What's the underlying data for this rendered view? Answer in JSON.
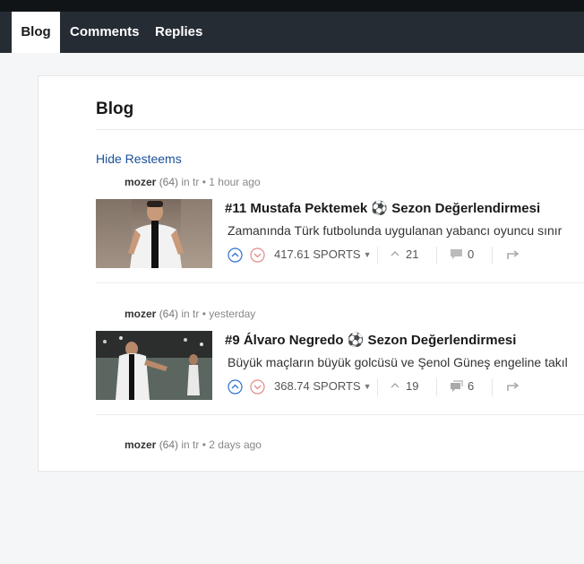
{
  "tabs": [
    {
      "label": "Blog",
      "active": true
    },
    {
      "label": "Comments",
      "active": false
    },
    {
      "label": "Replies",
      "active": false
    }
  ],
  "page_title": "Blog",
  "hide_resteems": "Hide Resteems",
  "posts": [
    {
      "author": "mozer",
      "reputation": "(64)",
      "category": "in tr",
      "time": "1 hour ago",
      "title": "#11 Mustafa Pektemek ⚽ Sezon Değerlendirmesi",
      "excerpt": "Zamanında Türk futbolunda uygulanan yabancı oyuncu sınır",
      "payout": "417.61 SPORTS",
      "votes": "21",
      "comments": "0"
    },
    {
      "author": "mozer",
      "reputation": "(64)",
      "category": "in tr",
      "time": "yesterday",
      "title": "#9 Álvaro Negredo ⚽ Sezon Değerlendirmesi",
      "excerpt": "Büyük maçların büyük golcüsü ve Şenol Güneş engeline takıl",
      "payout": "368.74 SPORTS",
      "votes": "19",
      "comments": "6"
    },
    {
      "author": "mozer",
      "reputation": "(64)",
      "category": "in tr",
      "time": "2 days ago"
    }
  ],
  "colors": {
    "topbar": "#111417",
    "tabbar": "#262c33",
    "link": "#1a5099",
    "upvote": "#2b6fd0",
    "downvote": "#e38a8a"
  },
  "icons": {
    "upvote": "chevron-up-circle-icon",
    "downvote": "chevron-down-circle-icon",
    "votes": "chevron-up-icon",
    "comments": "speech-bubble-icon",
    "resteem": "resteem-arrow-icon"
  }
}
